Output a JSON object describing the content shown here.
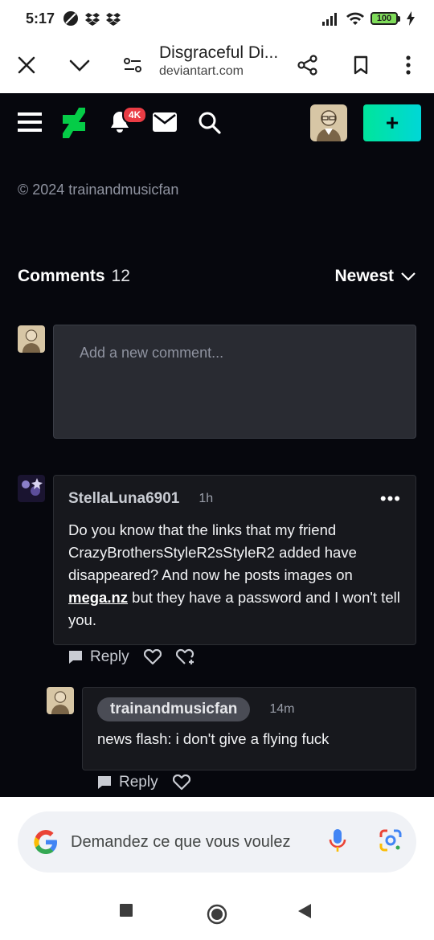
{
  "status": {
    "time": "5:17",
    "battery": "100"
  },
  "browser": {
    "title": "Disgraceful Di...",
    "url": "deviantart.com"
  },
  "nav": {
    "notif_badge": "4K",
    "create_symbol": "+"
  },
  "copyright": "© 2024 trainandmusicfan",
  "comments": {
    "title": "Comments",
    "count": "12",
    "sort_label": "Newest",
    "new_placeholder": "Add a new comment...",
    "items": [
      {
        "user": "StellaLuna6901",
        "time": "1h",
        "body_before": "Do you know that the links that my friend CrazyBrothersStyleR2sStyleR2 added have disappeared? And now he posts images on ",
        "link": "mega.nz",
        "body_after": " but they have a password and I won't tell you.",
        "reply_label": "Reply"
      },
      {
        "user": "trainandmusicfan",
        "time": "14m",
        "body": "news flash: i don't give a flying fuck",
        "reply_label": "Reply"
      }
    ]
  },
  "google": {
    "placeholder": "Demandez ce que vous voulez",
    "logo": "G"
  },
  "colors": {
    "accent_green": "#00e59b",
    "page_bg": "#06070d",
    "badge_red": "#ea3c44"
  }
}
